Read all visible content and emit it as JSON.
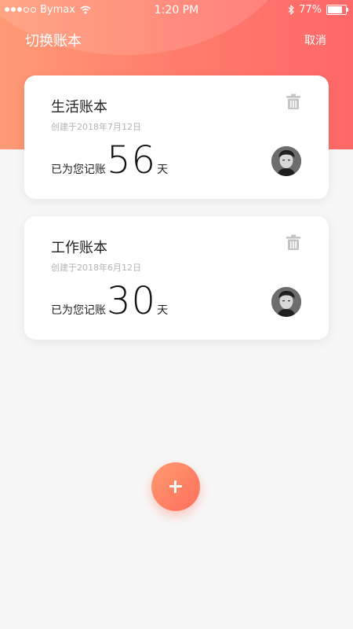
{
  "status_bar": {
    "carrier": "Bymax",
    "time": "1:20 PM",
    "battery": "77%",
    "battery_level": 0.77
  },
  "nav": {
    "title": "切换账本",
    "cancel": "取消"
  },
  "books": [
    {
      "name": "生活账本",
      "created": "创建于2018年7月12日",
      "count_prefix": "已为您记账",
      "days": "56",
      "count_suffix": "天"
    },
    {
      "name": "工作账本",
      "created": "创建于2018年6月12日",
      "count_prefix": "已为您记账",
      "days": "30",
      "count_suffix": "天"
    }
  ],
  "icons": {
    "trash": "trash-icon",
    "add": "plus-icon",
    "wifi": "wifi-icon",
    "bluetooth": "bluetooth-icon",
    "battery": "battery-icon"
  },
  "colors": {
    "header_start": "#ff9a74",
    "header_end": "#ff6868",
    "fab": "#ff7b62"
  }
}
